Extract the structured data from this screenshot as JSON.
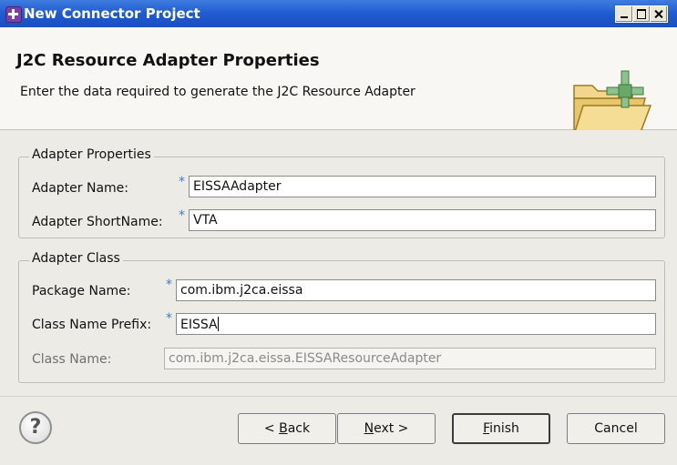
{
  "window": {
    "title": "New Connector Project"
  },
  "header": {
    "title": "J2C Resource Adapter Properties",
    "description": "Enter the data required to generate the J2C Resource Adapter"
  },
  "groups": {
    "adapter_properties": {
      "legend": "Adapter Properties",
      "adapter_name": {
        "label": "Adapter Name:",
        "value": "EISSAAdapter",
        "required": "*"
      },
      "adapter_short_name": {
        "label": "Adapter ShortName:",
        "value": "VTA",
        "required": "*"
      }
    },
    "adapter_class": {
      "legend": "Adapter Class",
      "package_name": {
        "label": "Package Name:",
        "value": "com.ibm.j2ca.eissa",
        "required": "*"
      },
      "class_name_prefix": {
        "label": "Class Name Prefix:",
        "value": "EISSA",
        "required": "*"
      },
      "class_name": {
        "label": "Class Name:",
        "value": "com.ibm.j2ca.eissa.EISSAResourceAdapter"
      }
    }
  },
  "buttons": {
    "help": "?",
    "back": {
      "pre": "< ",
      "mnemonic": "B",
      "rest": "ack"
    },
    "next": {
      "mnemonic": "N",
      "rest": "ext >"
    },
    "finish": {
      "mnemonic": "F",
      "rest": "inish"
    },
    "cancel": "Cancel"
  },
  "icons": {
    "window": "connector-project-icon",
    "wizard": "folder-connector-icon",
    "help": "help-icon"
  },
  "colors": {
    "titlebar": "#1f5bd1",
    "required_marker": "#3a7bd5"
  }
}
